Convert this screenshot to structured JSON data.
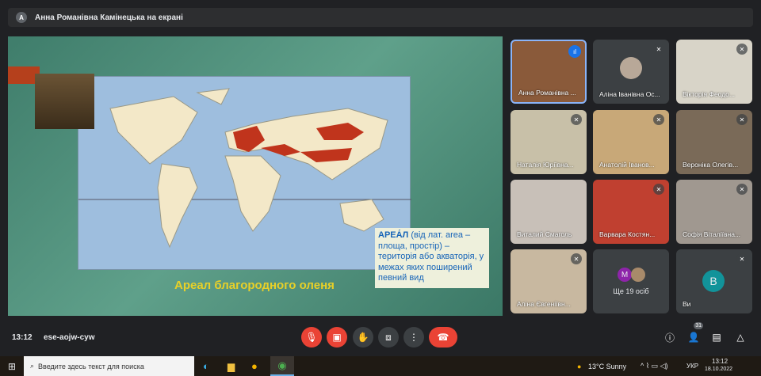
{
  "presenter_banner": {
    "avatar_letter": "А",
    "text": "Анна Романівна Камінецька на екрані"
  },
  "slide": {
    "caption": "Ареал благородного оленя",
    "note_title": "АРЕА́Л",
    "note_body": " (від лат. area – площа, простір) – територія або акваторія, у межах яких поширений певний вид",
    "colors": {
      "range": "#c0341c",
      "note_text": "#1664b8",
      "caption": "#e8d028"
    }
  },
  "participants": [
    {
      "name": "Анна Романівна ...",
      "speaking": true
    },
    {
      "name": "Аліна Іванівна Ос...",
      "muted": true
    },
    {
      "name": "Вікторія Феодо...",
      "muted": true
    },
    {
      "name": "Наталія Юріївна...",
      "muted": true
    },
    {
      "name": "Анатолій Іванов...",
      "muted": true
    },
    {
      "name": "Вероніка Олегів...",
      "muted": true
    },
    {
      "name": "Виталий Смаголь",
      "muted": false
    },
    {
      "name": "Варвара Костян...",
      "muted": true
    },
    {
      "name": "Софія Віталіївна...",
      "muted": true
    },
    {
      "name": "Аліна Євгеніївн...",
      "muted": true
    }
  ],
  "more_tile": {
    "avatar_letter": "M",
    "label": "Ще 19 осіб"
  },
  "self_tile": {
    "avatar_letter": "В",
    "name": "Ви"
  },
  "controls": {
    "time": "13:12",
    "meeting_code": "ese-aojw-cyw",
    "participant_count": "31"
  },
  "taskbar": {
    "search_placeholder": "Введите здесь текст для поиска",
    "weather": "13°C  Sunny",
    "lang": "УКР",
    "clock": "13:12",
    "date": "18.10.2022"
  }
}
